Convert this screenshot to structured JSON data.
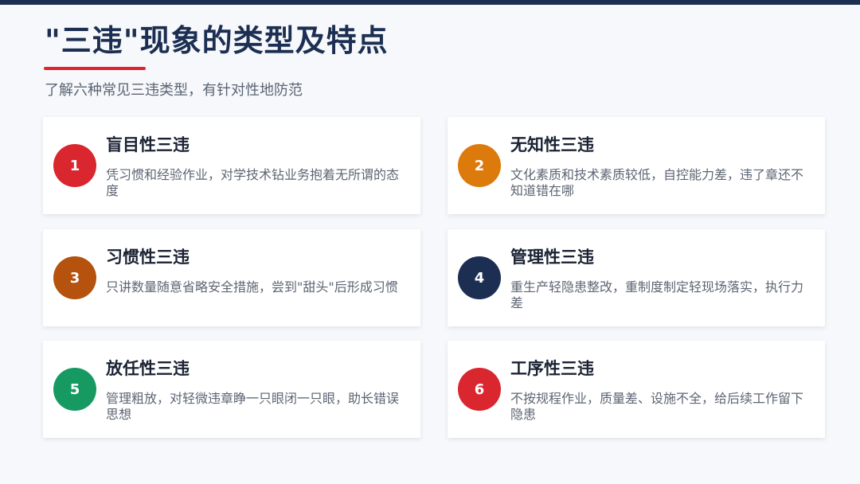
{
  "header": {
    "title": "\"三违\"现象的类型及特点",
    "subtitle": "了解六种常见三违类型，有针对性地防范"
  },
  "colors": {
    "top_bar": "#1c2f52",
    "title": "#1c2f52",
    "underline_accent": "#d9262f"
  },
  "cards": [
    {
      "number": "1",
      "title": "盲目性三违",
      "description": "凭习惯和经验作业，对学技术钻业务抱着无所谓的态度",
      "color": "#d9262f"
    },
    {
      "number": "2",
      "title": "无知性三违",
      "description": "文化素质和技术素质较低，自控能力差，违了章还不知道错在哪",
      "color": "#dd7a0c"
    },
    {
      "number": "3",
      "title": "习惯性三违",
      "description": "只讲数量随意省略安全措施，尝到\"甜头\"后形成习惯",
      "color": "#b4520e"
    },
    {
      "number": "4",
      "title": "管理性三违",
      "description": "重生产轻隐患整改，重制度制定轻现场落实，执行力差",
      "color": "#1c2f52"
    },
    {
      "number": "5",
      "title": "放任性三违",
      "description": "管理粗放，对轻微违章睁一只眼闭一只眼，助长错误思想",
      "color": "#169a62"
    },
    {
      "number": "6",
      "title": "工序性三违",
      "description": "不按规程作业，质量差、设施不全，给后续工作留下隐患",
      "color": "#d9262f"
    }
  ]
}
